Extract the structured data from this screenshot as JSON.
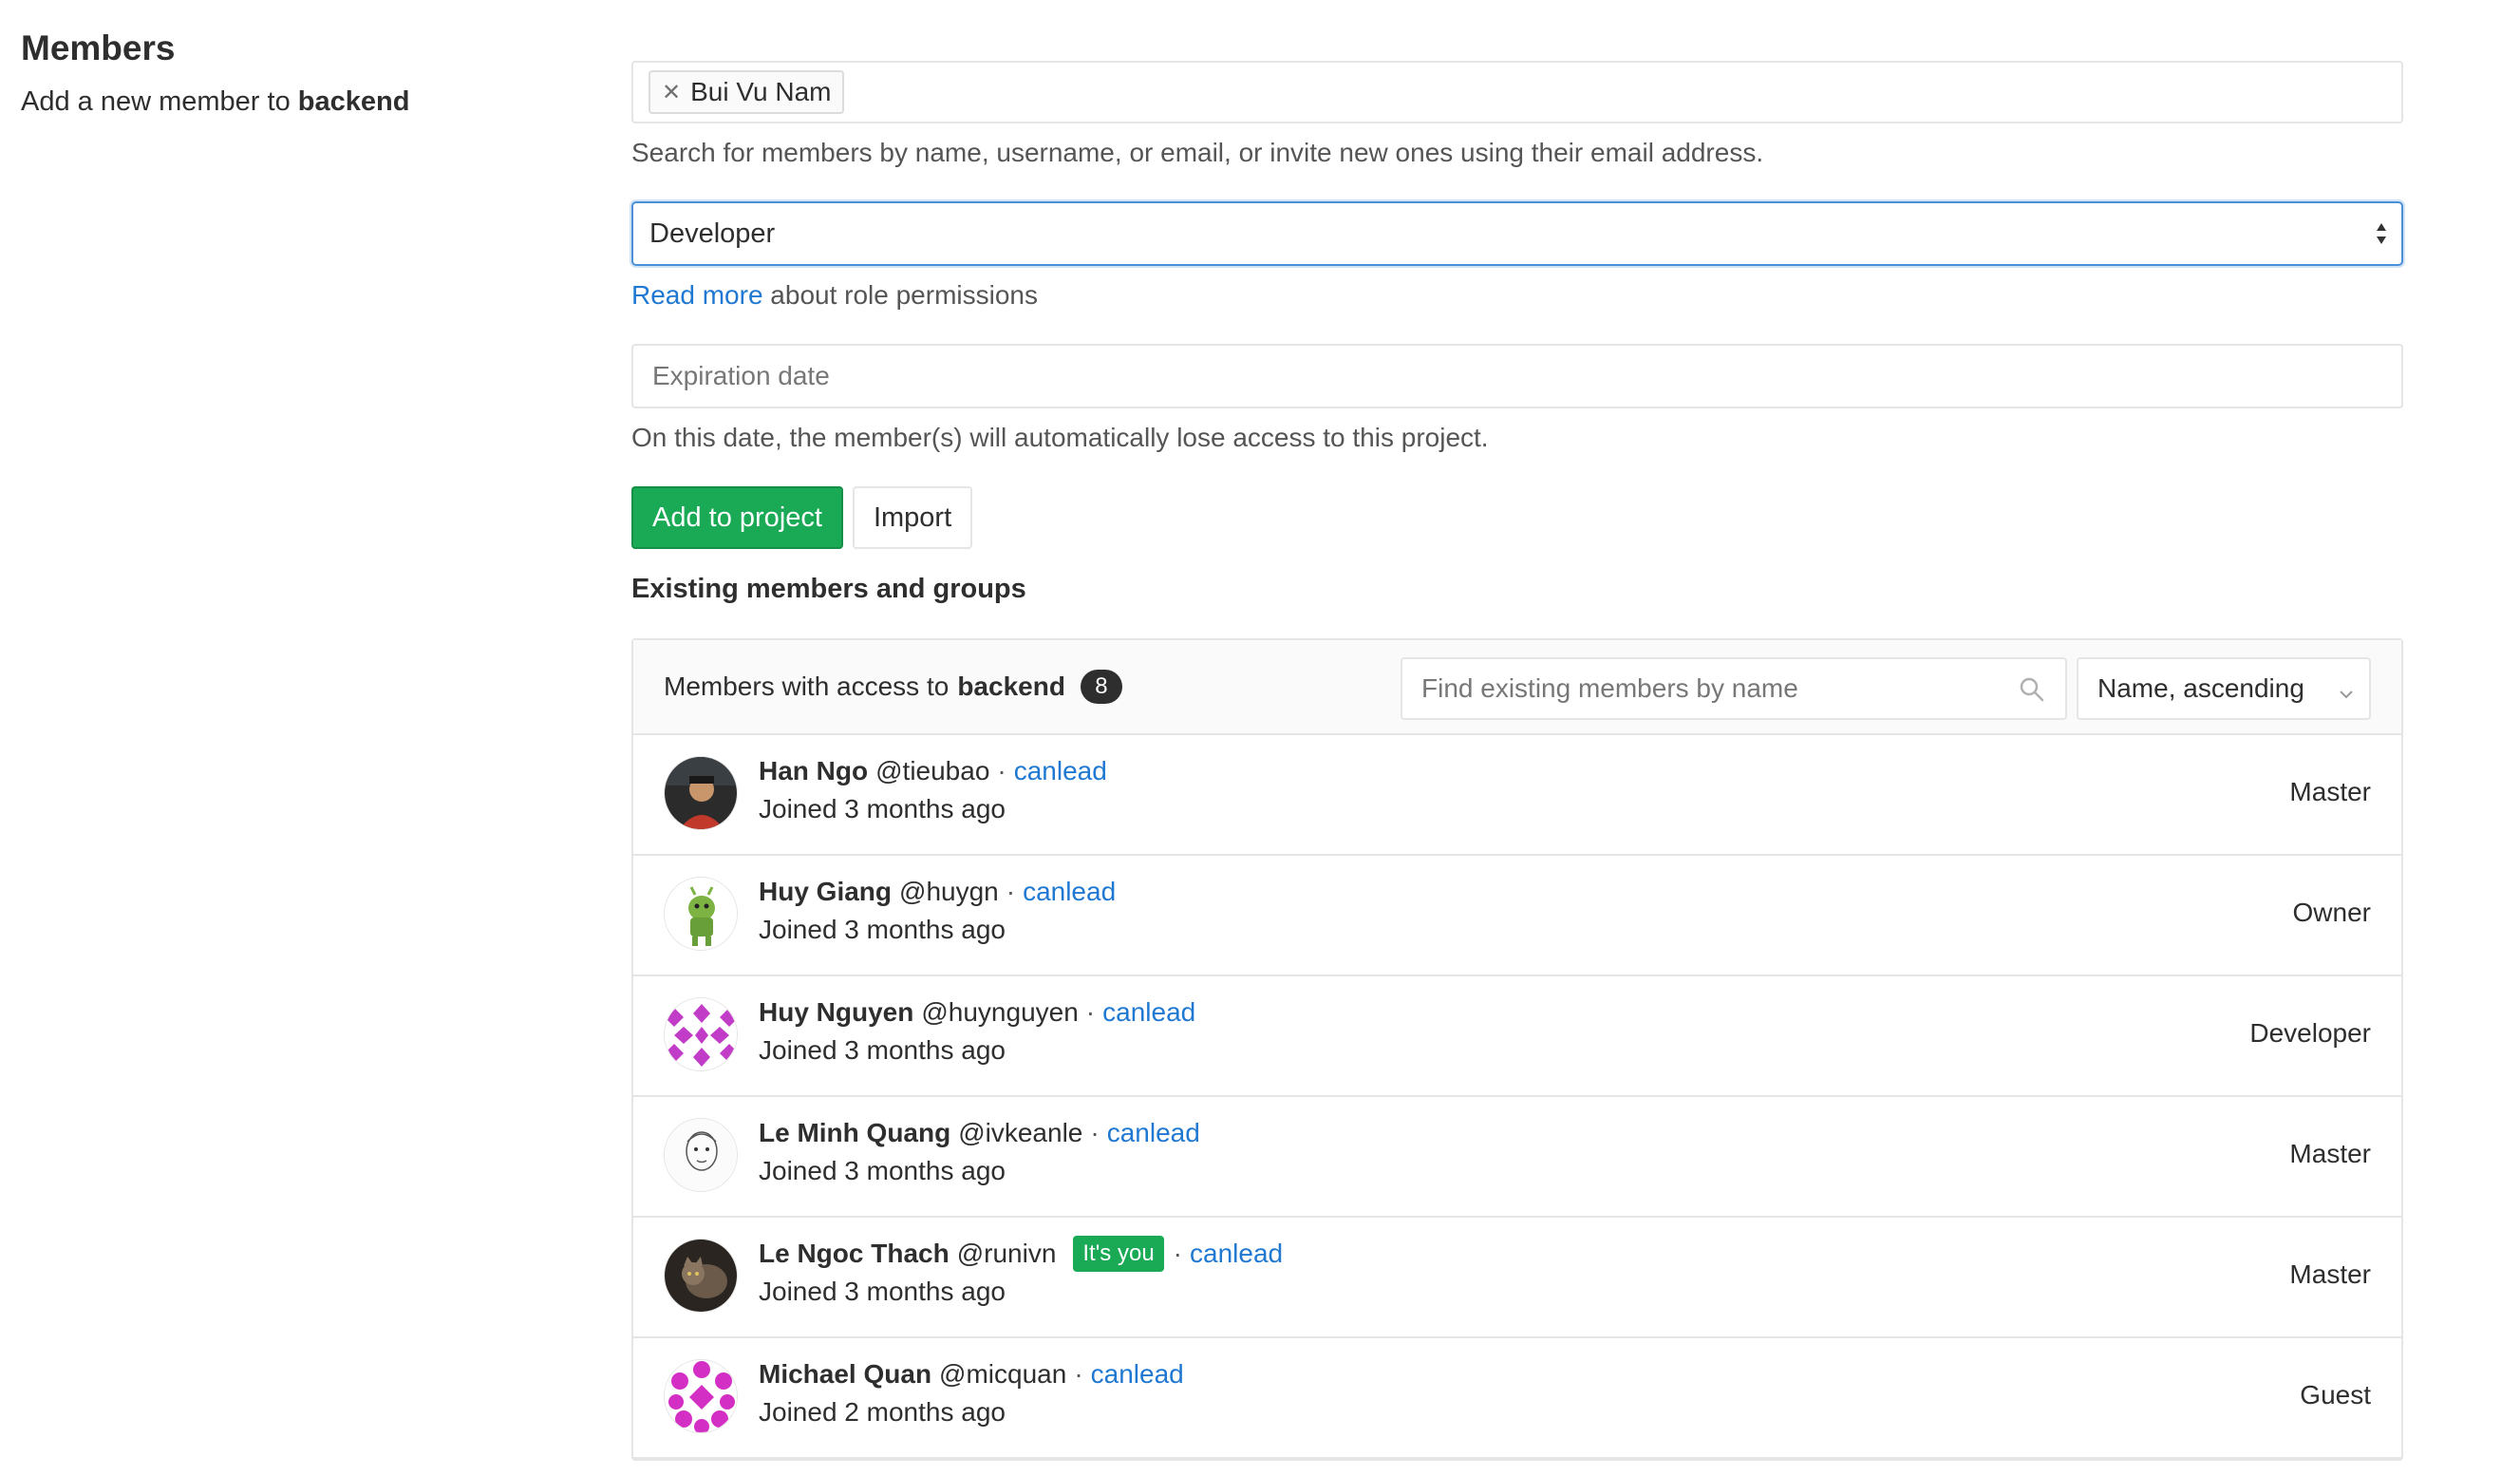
{
  "sidebar": {
    "title": "Members",
    "subtitle_prefix": "Add a new member to",
    "project": "backend"
  },
  "form": {
    "selected_user": "Bui Vu Nam",
    "search_help": "Search for members by name, username, or email, or invite new ones using their email address.",
    "role_value": "Developer",
    "read_more_link": "Read more",
    "read_more_suffix": "about role permissions",
    "expiration_placeholder": "Expiration date",
    "expiration_help": "On this date, the member(s) will automatically lose access to this project.",
    "add_button": "Add to project",
    "import_button": "Import"
  },
  "existing": {
    "title": "Existing members and groups",
    "panel_prefix": "Members with access to",
    "project": "backend",
    "count": "8",
    "search_placeholder": "Find existing members by name",
    "sort_label": "Name, ascending"
  },
  "members": [
    {
      "name": "Han Ngo",
      "username": "@tieubao",
      "group": "canlead",
      "joined": "Joined 3 months ago",
      "role": "Master",
      "avatar": "photo-person"
    },
    {
      "name": "Huy Giang",
      "username": "@huygn",
      "group": "canlead",
      "joined": "Joined 3 months ago",
      "role": "Owner",
      "avatar": "green-android"
    },
    {
      "name": "Huy Nguyen",
      "username": "@huynguyen",
      "group": "canlead",
      "joined": "Joined 3 months ago",
      "role": "Developer",
      "avatar": "identicon-purple"
    },
    {
      "name": "Le Minh Quang",
      "username": "@ivkeanle",
      "group": "canlead",
      "joined": "Joined 3 months ago",
      "role": "Master",
      "avatar": "sketch-face"
    },
    {
      "name": "Le Ngoc Thach",
      "username": "@runivn",
      "badge": "It's you",
      "group": "canlead",
      "joined": "Joined 3 months ago",
      "role": "Master",
      "avatar": "photo-cat"
    },
    {
      "name": "Michael Quan",
      "username": "@micquan",
      "group": "canlead",
      "joined": "Joined 2 months ago",
      "role": "Guest",
      "avatar": "identicon-magenta"
    }
  ],
  "colors": {
    "primary_green": "#1aaa55",
    "link_blue": "#1f78d1",
    "border": "#e5e5e5"
  }
}
